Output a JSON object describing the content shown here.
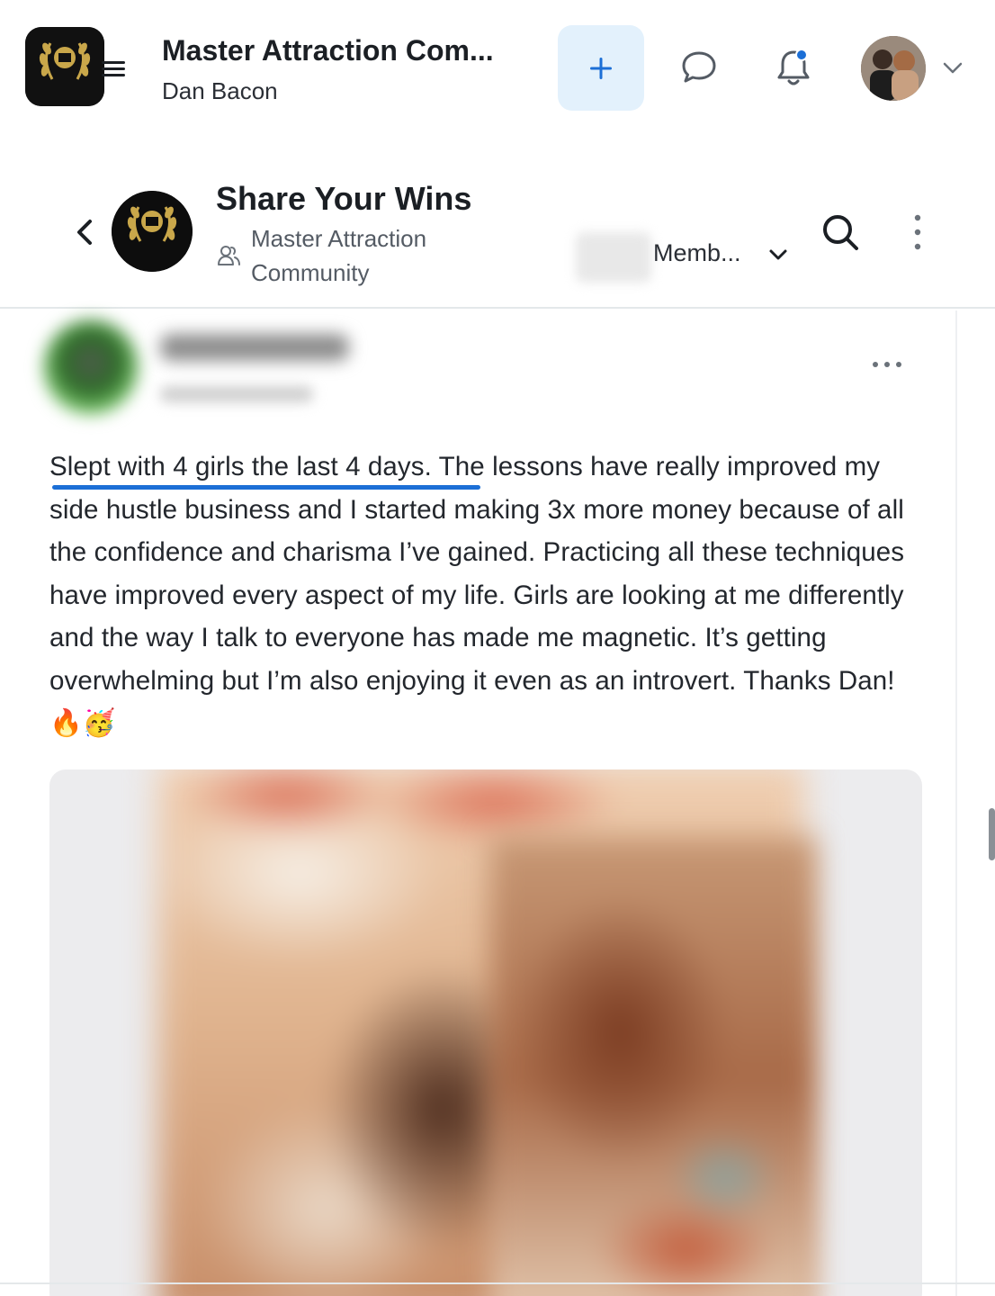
{
  "app_header": {
    "title": "Master Attraction Com...",
    "subtitle": "Dan Bacon",
    "logo_text": "MASTER ATTRACTION COMMUNITY"
  },
  "space_header": {
    "title": "Share Your Wins",
    "community": "Master Attraction Community",
    "members_label": "Memb...",
    "logo_text": "MASTER ATTRACTION COMMUNITY"
  },
  "post": {
    "highlight_text": "Slept with 4 girls the last 4 days.",
    "body_text": " The lessons have really improved my side hustle business and I started making 3x more money because of all the confidence and charisma I’ve gained. Practicing all these techniques have improved every aspect of my life. Girls are looking at me differently and the way I talk to everyone has made me magnetic. It’s getting overwhelming but I’m also enjoying it even as an introvert. Thanks Dan! 🔥🥳"
  },
  "colors": {
    "accent": "#1c6fd6",
    "add_button_bg": "#e3f1fc",
    "notification_dot": "#1c6fd6"
  },
  "icons": [
    "menu-icon",
    "plus-icon",
    "chat-icon",
    "bell-icon",
    "chevron-down-icon",
    "back-icon",
    "group-icon",
    "search-icon",
    "more-vert-icon",
    "more-horizontal-icon"
  ]
}
